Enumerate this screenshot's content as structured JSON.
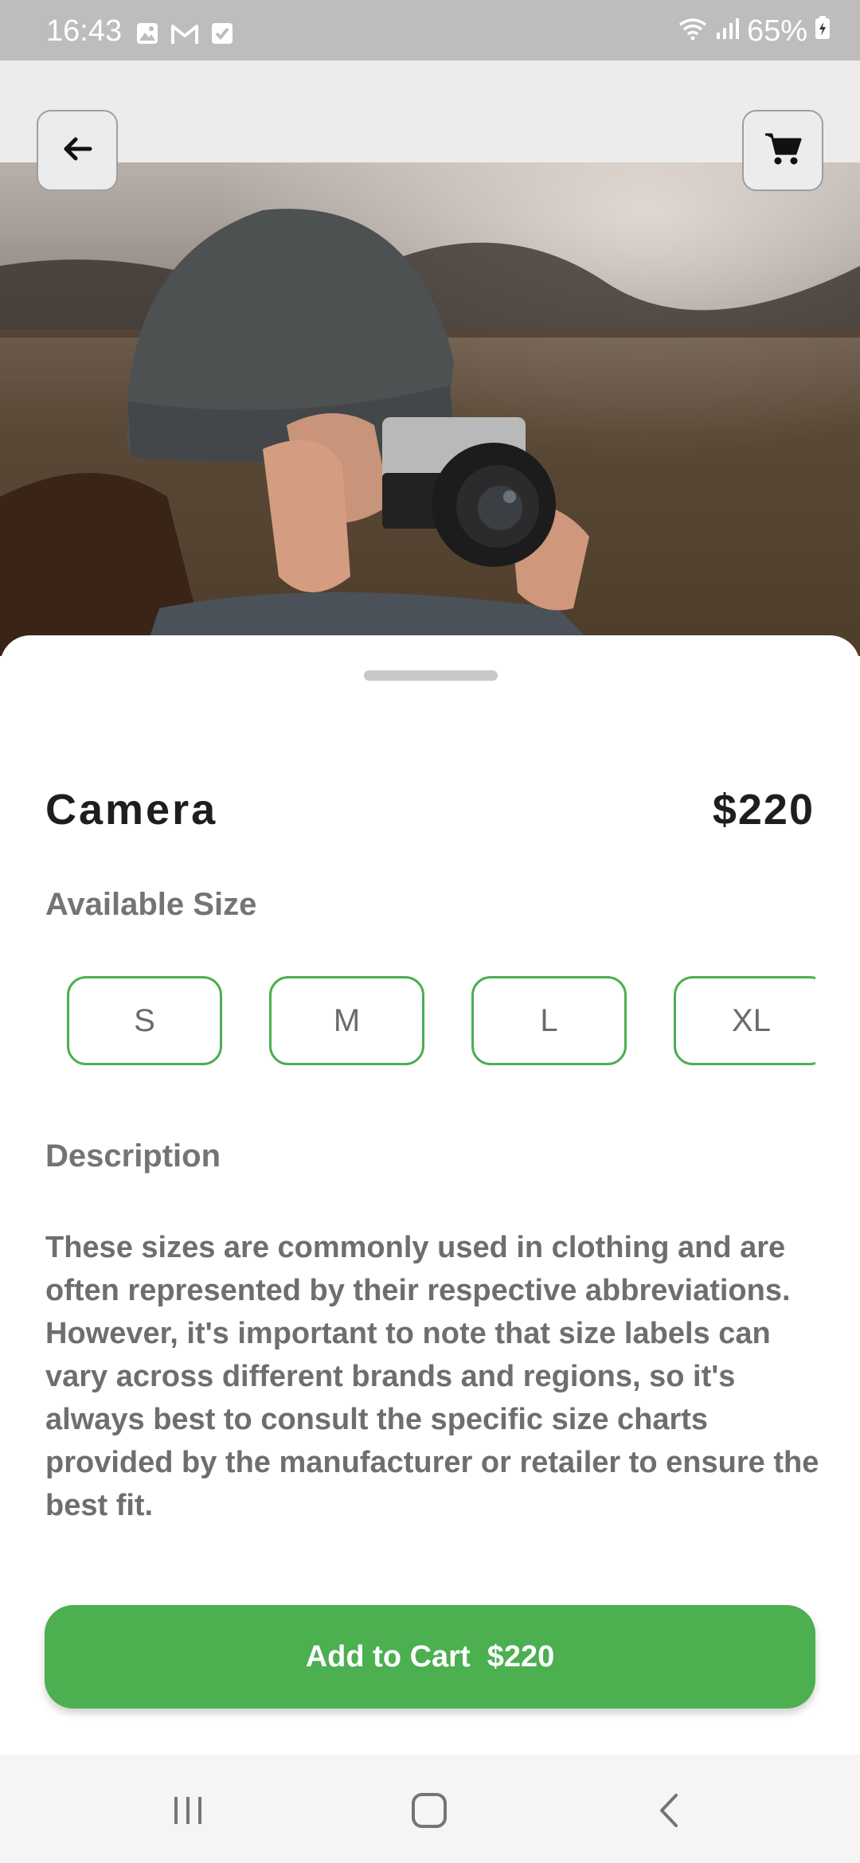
{
  "status_bar": {
    "time": "16:43",
    "battery": "65%",
    "left_icons": [
      "gallery-icon",
      "gmail-icon",
      "check-box-icon"
    ],
    "right_icons": [
      "wifi-icon",
      "signal-icon",
      "battery-icon"
    ]
  },
  "header": {
    "back_icon": "arrow-left-icon",
    "cart_icon": "shopping-cart-icon"
  },
  "product": {
    "name": "Camera",
    "price": "$220"
  },
  "sizes": {
    "label": "Available Size",
    "options": [
      "S",
      "M",
      "L",
      "XL"
    ]
  },
  "description": {
    "label": "Description",
    "text": "These sizes are commonly used in clothing and are often represented by their respective abbreviations. However, it's important to note that size labels can vary across different brands and regions, so it's always best to consult the specific size charts provided by the manufacturer or retailer to ensure the best fit."
  },
  "cta": {
    "label": "Add to Cart  $220"
  },
  "colors": {
    "accent": "#4caf50",
    "text_dark": "#1e1e1e",
    "text_muted": "#747474"
  },
  "navbar": {
    "icons": [
      "recent-apps-icon",
      "home-icon",
      "back-icon"
    ]
  }
}
